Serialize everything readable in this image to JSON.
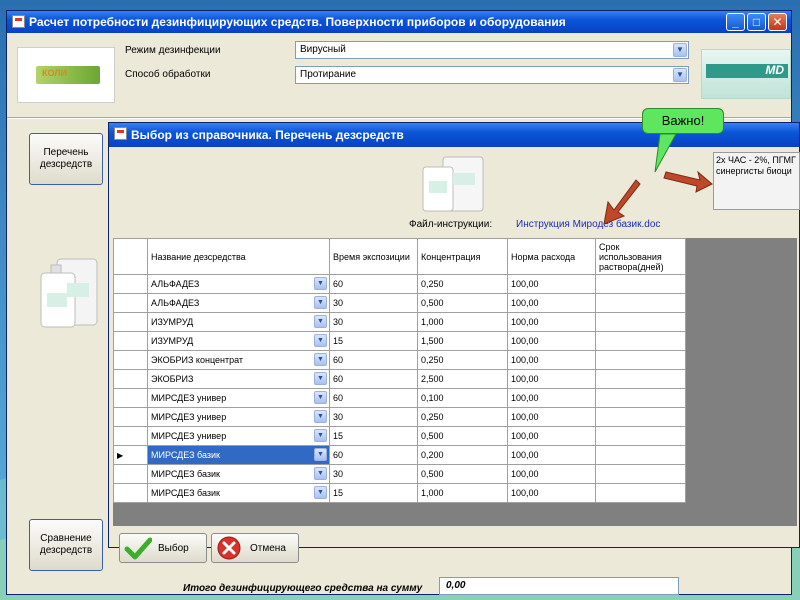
{
  "main_window": {
    "title": "Расчет потребности дезинфицирующих средств. Поверхности приборов и оборудования",
    "controls": {
      "minimize": "_",
      "maximize": "□",
      "close": "✕"
    },
    "mode_label": "Режим дезинфекции",
    "mode_value": "Вирусный",
    "method_label": "Способ обработки",
    "method_value": "Протирание",
    "button_list": "Перечень дезсредств",
    "button_compare": "Сравнение дезсредств",
    "total_label": "Итого дезинфицирующего средства на сумму",
    "total_value": "0,00"
  },
  "dialog": {
    "title": "Выбор из справочника. Перечень дезсредств",
    "file_label": "Файл-инструкции:",
    "file_link": "Инструкция Миродез базик.doc",
    "ok_label": "Выбор",
    "cancel_label": "Отмена",
    "columns": [
      "Название дезсредства",
      "Время экспозиции",
      "Концентрация",
      "Норма расхода",
      "Срок использования раствора(дней)"
    ],
    "rows": [
      {
        "name": "АЛЬФАДЕЗ",
        "time": "60",
        "conc": "0,250",
        "norm": "100,00",
        "term": ""
      },
      {
        "name": "АЛЬФАДЕЗ",
        "time": "30",
        "conc": "0,500",
        "norm": "100,00",
        "term": ""
      },
      {
        "name": "ИЗУМРУД",
        "time": "30",
        "conc": "1,000",
        "norm": "100,00",
        "term": ""
      },
      {
        "name": "ИЗУМРУД",
        "time": "15",
        "conc": "1,500",
        "norm": "100,00",
        "term": ""
      },
      {
        "name": "ЭКОБРИЗ концентрат",
        "time": "60",
        "conc": "0,250",
        "norm": "100,00",
        "term": ""
      },
      {
        "name": "ЭКОБРИЗ",
        "time": "60",
        "conc": "2,500",
        "norm": "100,00",
        "term": ""
      },
      {
        "name": "МИРСДЕЗ универ",
        "time": "60",
        "conc": "0,100",
        "norm": "100,00",
        "term": ""
      },
      {
        "name": "МИРСДЕЗ универ",
        "time": "30",
        "conc": "0,250",
        "norm": "100,00",
        "term": ""
      },
      {
        "name": "МИРСДЕЗ универ",
        "time": "15",
        "conc": "0,500",
        "norm": "100,00",
        "term": ""
      },
      {
        "name": "МИРСДЕЗ базик",
        "time": "60",
        "conc": "0,200",
        "norm": "100,00",
        "term": ""
      },
      {
        "name": "МИРСДЕЗ базик",
        "time": "30",
        "conc": "0,500",
        "norm": "100,00",
        "term": ""
      },
      {
        "name": "МИРСДЕЗ базик",
        "time": "15",
        "conc": "1,000",
        "norm": "100,00",
        "term": ""
      }
    ],
    "selected_row": 9
  },
  "note": {
    "text_line1": "2х ЧАС - 2%, ПГМГ",
    "text_line2": "синергисты биоци"
  },
  "callout": {
    "text": "Важно!"
  },
  "logo_left_text": "КОЛИ"
}
